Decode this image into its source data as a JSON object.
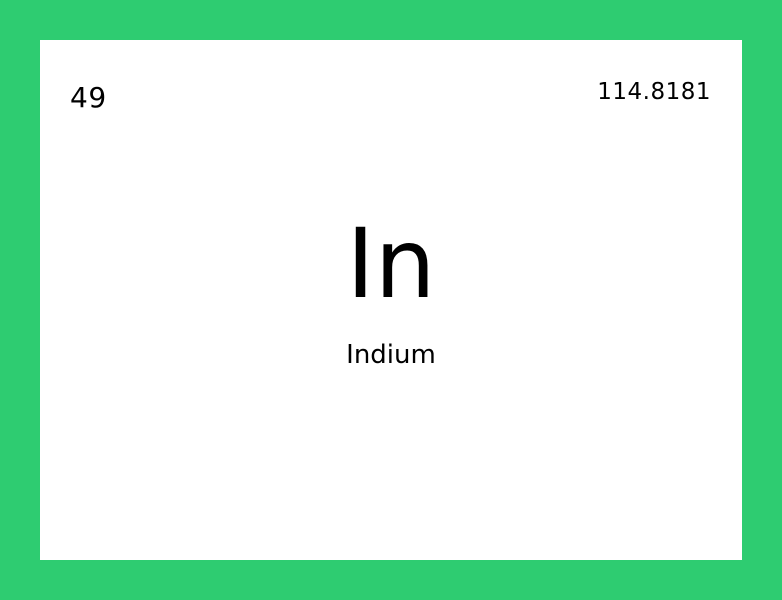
{
  "colors": {
    "border": "#2ecc71",
    "card_background": "#ffffff",
    "text": "#000000"
  },
  "element": {
    "atomic_number": "49",
    "atomic_mass": "114.8181",
    "symbol": "In",
    "name": "Indium"
  }
}
